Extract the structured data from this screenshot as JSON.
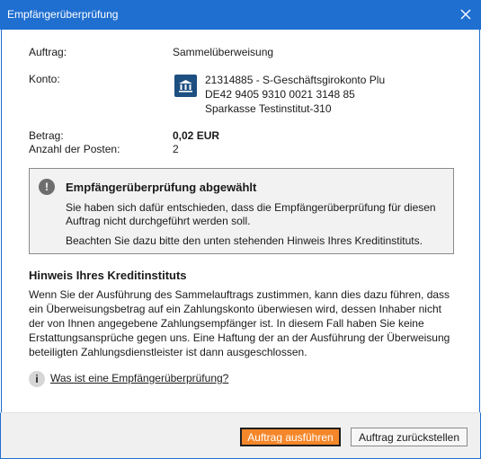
{
  "window": {
    "title": "Empfängerüberprüfung"
  },
  "details": {
    "order_label": "Auftrag:",
    "order_value": "Sammelüberweisung",
    "account_label": "Konto:",
    "account_lines": [
      "21314885 - S-Geschäftsgirokonto Plu",
      "DE42 9405 9310 0021 3148 85",
      "Sparkasse Testinstitut-310"
    ],
    "amount_label": "Betrag:",
    "amount_value": "0,02 EUR",
    "count_label": "Anzahl der Posten:",
    "count_value": "2"
  },
  "notice": {
    "title": "Empfängerüberprüfung abgewählt",
    "body1": "Sie haben sich dafür entschieden, dass die Empfängerüberprüfung für diesen Auftrag nicht durchgeführt werden soll.",
    "body2": "Beachten Sie dazu bitte den unten stehenden Hinweis Ihres Kreditinstituts."
  },
  "hint": {
    "title": "Hinweis Ihres Kreditinstituts",
    "body": "Wenn Sie der Ausführung des Sammelauftrags zustimmen, kann dies dazu führen, dass ein Überweisungsbetrag auf ein Zahlungskonto überwiesen wird, dessen Inhaber nicht der von Ihnen angegebene Zahlungsempfänger ist. In diesem Fall haben Sie keine Erstattungsansprüche gegen uns. Eine Haftung der an der Ausführung der Überweisung beteiligten Zahlungsdienstleister ist dann ausgeschlossen."
  },
  "info": {
    "link_text": "Was ist eine Empfängerüberprüfung?",
    "icon_glyph": "i"
  },
  "buttons": {
    "primary_label": "Auftrag ausführen",
    "secondary_label": "Auftrag zurückstellen"
  },
  "icons": {
    "close": "close-icon",
    "bank": "bank-icon",
    "warning": "warning-icon",
    "info": "info-icon"
  },
  "colors": {
    "titlebar": "#1f6fd0",
    "primary_button": "#f5872a",
    "bank_icon": "#1d4f80"
  }
}
